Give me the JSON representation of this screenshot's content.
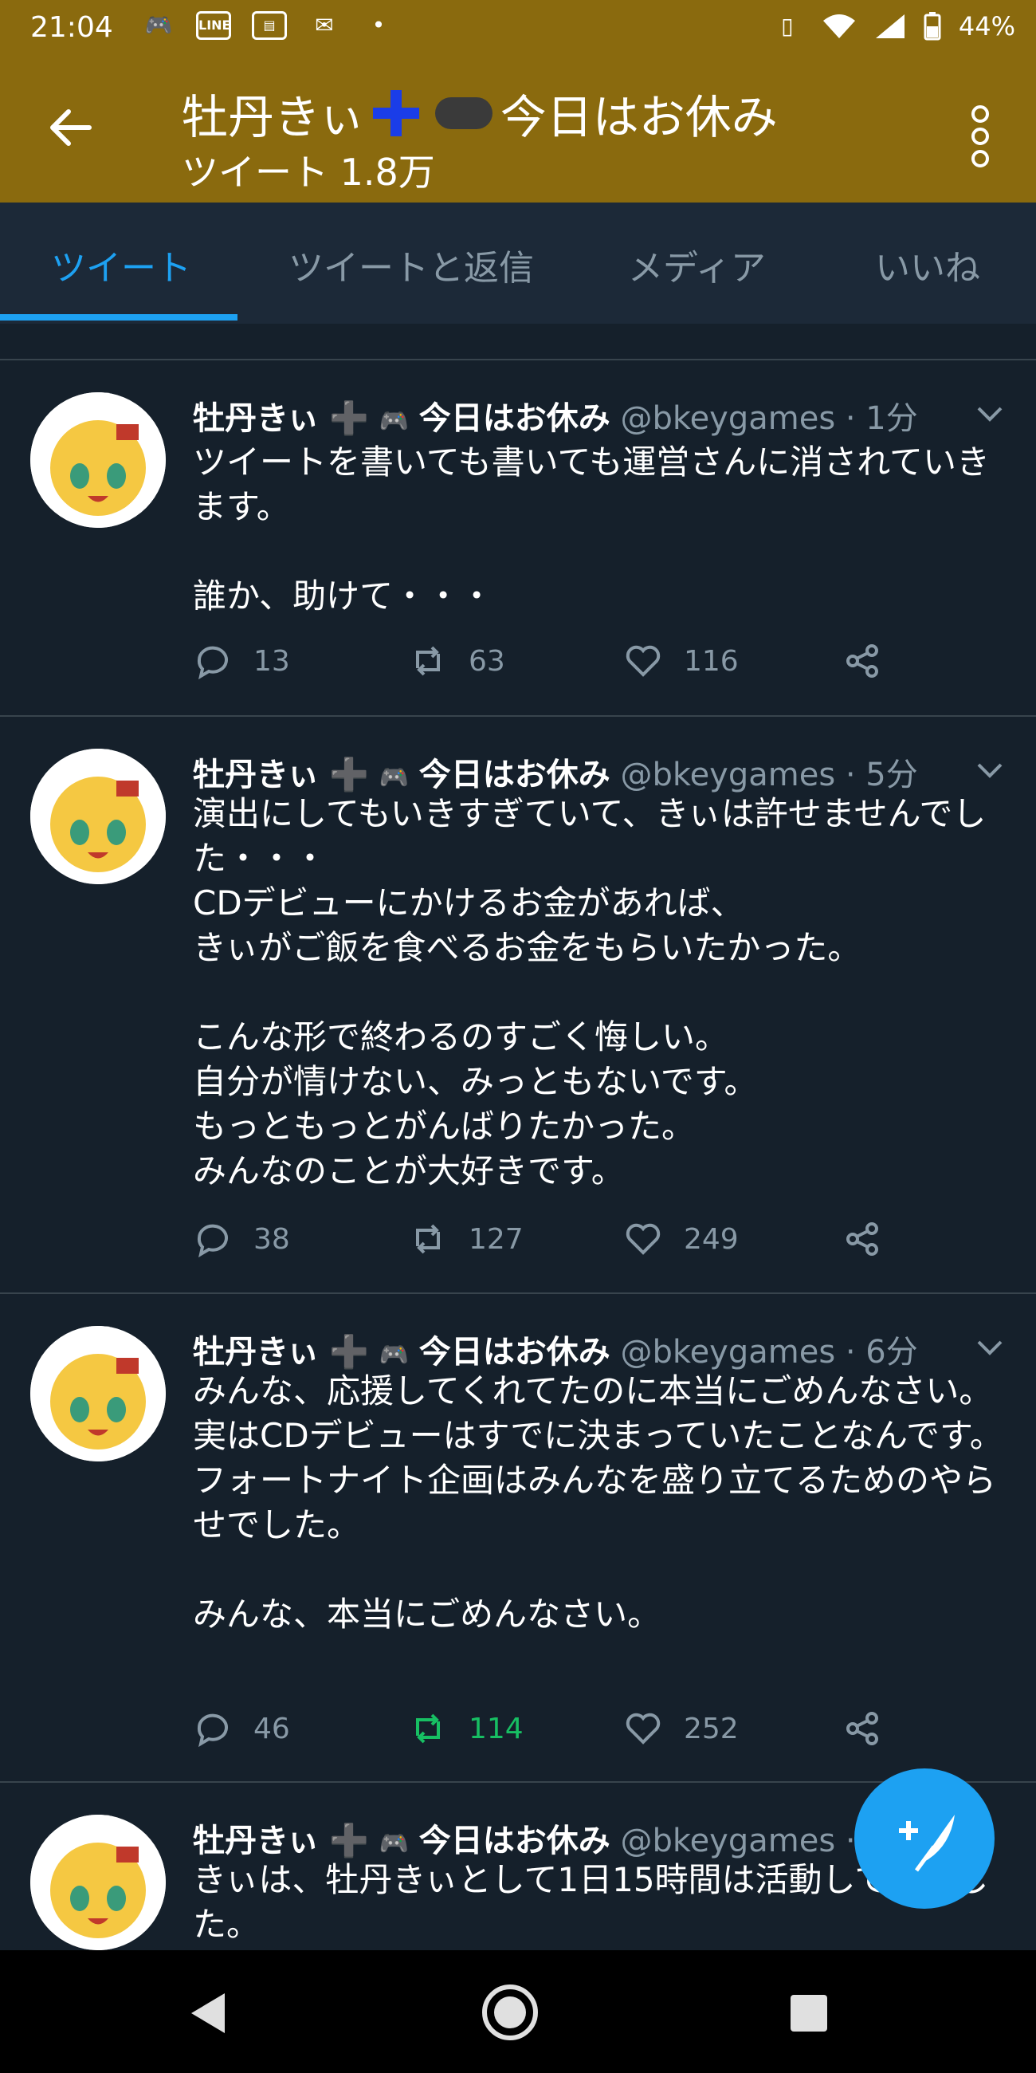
{
  "status_bar": {
    "time": "21:04",
    "battery": "44%",
    "left_icons": [
      "game-notification-icon",
      "line-icon",
      "app-icon",
      "mail-icon",
      "dot-icon"
    ],
    "right_icons": [
      "vibrate-icon",
      "wifi-icon",
      "signal-icon",
      "battery-icon"
    ]
  },
  "header": {
    "name_part1": "牡丹きぃ",
    "name_part2": "今日はお休み",
    "subtitle": "ツイート 1.8万"
  },
  "tabs": [
    {
      "label": "ツイート",
      "active": true
    },
    {
      "label": "ツイートと返信",
      "active": false
    },
    {
      "label": "メディア",
      "active": false
    },
    {
      "label": "いいね",
      "active": false
    }
  ],
  "tweets": [
    {
      "name1": "牡丹きぃ",
      "name2": "今日はお休み",
      "handle_time": "@bkeygames · 1分",
      "text": "ツイートを書いても書いても運営さんに消されていきます。\n\n誰か、助けて・・・",
      "replies": "13",
      "retweets": "63",
      "likes": "116",
      "retweeted": false
    },
    {
      "name1": "牡丹きぃ",
      "name2": "今日はお休み",
      "handle_time": "@bkeygames · 5分",
      "text": "演出にしてもいきすぎていて、きぃは許せませんでした・・・\nCDデビューにかけるお金があれば、\nきぃがご飯を食べるお金をもらいたかった。\n\nこんな形で終わるのすごく悔しい。\n自分が情けない、みっともないです。\nもっともっとがんばりたかった。\nみんなのことが大好きです。",
      "replies": "38",
      "retweets": "127",
      "likes": "249",
      "retweeted": false
    },
    {
      "name1": "牡丹きぃ",
      "name2": "今日はお休み",
      "handle_time": "@bkeygames · 6分",
      "text": "みんな、応援してくれてたのに本当にごめんなさい。\n実はCDデビューはすでに決まっていたことなんです。\nフォートナイト企画はみんなを盛り立てるためのやらせでした。\n\nみんな、本当にごめんなさい。",
      "replies": "46",
      "retweets": "114",
      "likes": "252",
      "retweeted": true
    },
    {
      "name1": "牡丹きぃ",
      "name2": "今日はお休み",
      "handle_time": "@bkeygames ·",
      "text": "きぃは、牡丹きぃとして1日15時間は活動していました。",
      "retweeted": false
    }
  ],
  "colors": {
    "header_bg": "#8a6a0e",
    "accent": "#1da1f2",
    "retweet_active": "#17bf63",
    "background": "#15202b"
  }
}
